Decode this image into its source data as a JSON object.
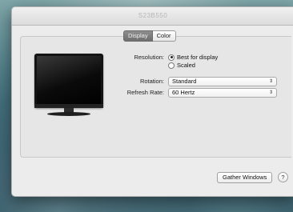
{
  "window": {
    "title": "S23B550"
  },
  "tabs": [
    {
      "label": "Display",
      "selected": true
    },
    {
      "label": "Color",
      "selected": false
    }
  ],
  "resolution": {
    "label": "Resolution:",
    "options": [
      {
        "label": "Best for display",
        "checked": true
      },
      {
        "label": "Scaled",
        "checked": false
      }
    ]
  },
  "rotation": {
    "label": "Rotation:",
    "value": "Standard"
  },
  "refresh_rate": {
    "label": "Refresh Rate:",
    "value": "60 Hertz"
  },
  "footer": {
    "gather_windows_label": "Gather Windows",
    "help_label": "?"
  },
  "icons": {
    "monitor": "monitor-icon",
    "popup_arrows": "chevron-up-down-icon"
  }
}
